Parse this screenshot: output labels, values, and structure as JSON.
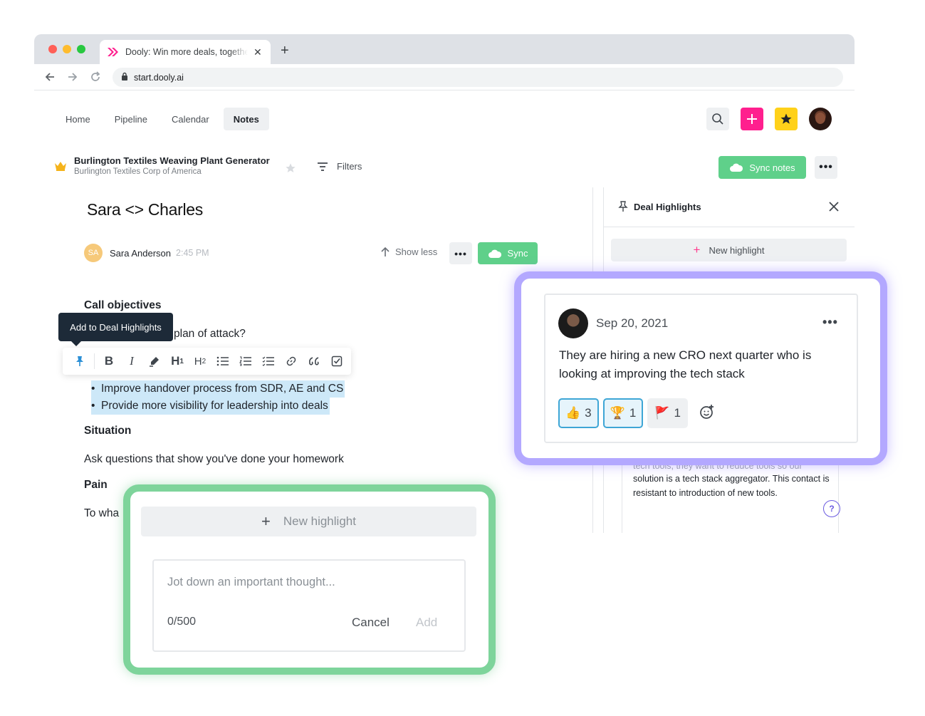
{
  "browser": {
    "tab_title": "Dooly: Win more deals, together",
    "url": "start.dooly.ai"
  },
  "nav": {
    "items": [
      "Home",
      "Pipeline",
      "Calendar",
      "Notes"
    ],
    "active": "Notes"
  },
  "deal": {
    "title": "Burlington Textiles Weaving Plant Generator",
    "company": "Burlington Textiles Corp of America",
    "filters_label": "Filters",
    "sync_notes_label": "Sync notes"
  },
  "note": {
    "title": "Sara <> Charles",
    "author_initials": "SA",
    "author_name": "Sara Anderson",
    "time": "2:45 PM",
    "show_less_label": "Show less",
    "sync_label": "Sync",
    "sections": {
      "call_objectives": "Call objectives",
      "plan_line": "plan of attack?",
      "bullets": [
        "Improve handover process from SDR, AE and CS",
        "Provide more visibility for leadership into deals"
      ],
      "situation": "Situation",
      "situation_text": "Ask questions that show you've done your homework",
      "pain": "Pain",
      "pain_text": "To wha"
    }
  },
  "tooltip": "Add to Deal Highlights",
  "toolbar": {
    "h1": "H",
    "h1_sub": "1",
    "h2": "H",
    "h2_sub": "2"
  },
  "panel": {
    "title": "Deal Highlights",
    "new_highlight_label": "New highlight",
    "under_text_faded": "tech tools, they want to reduce tools so our",
    "under_text": "solution is a tech stack aggregator. This contact is resistant to introduction of new tools.",
    "help": "?"
  },
  "highlight_card": {
    "date": "Sep 20, 2021",
    "text": "They are hiring a new CRO next quarter who is looking at improving the tech stack",
    "reactions": [
      {
        "emoji": "👍",
        "count": "3",
        "selected": true
      },
      {
        "emoji": "🏆",
        "count": "1",
        "selected": true
      },
      {
        "emoji": "🚩",
        "count": "1",
        "selected": false
      }
    ]
  },
  "new_highlight_form": {
    "button_label": "New highlight",
    "placeholder": "Jot down an important thought...",
    "count": "0/500",
    "cancel_label": "Cancel",
    "add_label": "Add"
  },
  "colors": {
    "brand_pink": "#ff1f8e",
    "star_yellow": "#ffd11a",
    "sync_green": "#5fd08a",
    "selection_blue": "#cde8f8",
    "purple_frame": "#b3a8ff",
    "green_frame": "#7ed49b"
  }
}
